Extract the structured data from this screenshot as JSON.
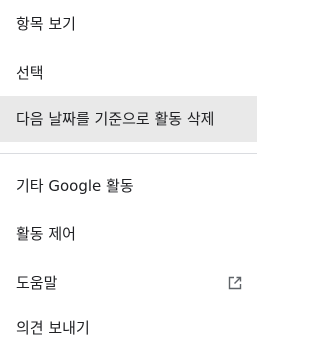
{
  "menu": {
    "items": [
      {
        "label": "항목 보기"
      },
      {
        "label": "선택"
      },
      {
        "label": "다음 날짜를 기준으로 활동 삭제"
      },
      {
        "label": "기타 Google 활동"
      },
      {
        "label": "활동 제어"
      },
      {
        "label": "도움말",
        "icon": "open-in-new-icon"
      },
      {
        "label": "의견 보내기"
      }
    ]
  }
}
